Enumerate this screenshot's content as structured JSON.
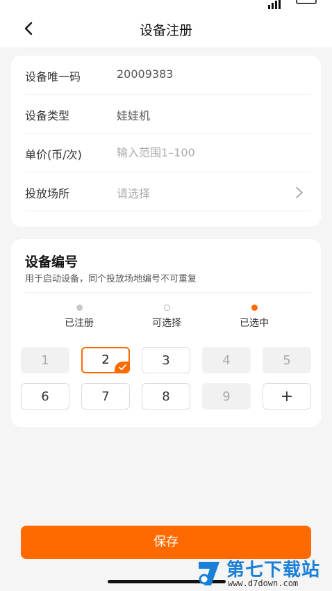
{
  "nav": {
    "title": "设备注册"
  },
  "form": {
    "rows": [
      {
        "label": "设备唯一码",
        "value": "20009383"
      },
      {
        "label": "设备类型",
        "value": "娃娃机"
      },
      {
        "label": "单价(币/次)",
        "placeholder": "输入范围1–100"
      },
      {
        "label": "投放场所",
        "value": "请选择"
      }
    ]
  },
  "numbering": {
    "title": "设备编号",
    "subtitle": "用于启动设备，同个投放场地编号不可重复",
    "legend": [
      {
        "label": "已注册",
        "state": "registered"
      },
      {
        "label": "可选择",
        "state": "selectable"
      },
      {
        "label": "已选中",
        "state": "selected"
      }
    ],
    "numbers": [
      {
        "label": "1",
        "state": "registered"
      },
      {
        "label": "2",
        "state": "selected"
      },
      {
        "label": "3",
        "state": "selectable"
      },
      {
        "label": "4",
        "state": "registered"
      },
      {
        "label": "5",
        "state": "registered"
      },
      {
        "label": "6",
        "state": "selectable"
      },
      {
        "label": "7",
        "state": "selectable"
      },
      {
        "label": "8",
        "state": "selectable"
      },
      {
        "label": "9",
        "state": "registered"
      },
      {
        "label": "+",
        "state": "add"
      }
    ]
  },
  "save": {
    "label": "保存"
  },
  "watermark": {
    "title": "第七下载站",
    "url": "www.d7down.com"
  },
  "colors": {
    "accent": "#ff6a00",
    "registered": "#f1f1f1",
    "watermark": "#1a7fd6"
  }
}
